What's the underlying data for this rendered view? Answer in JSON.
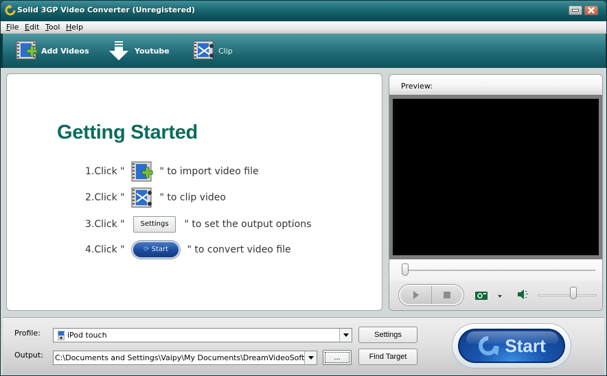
{
  "window": {
    "title": "Solid 3GP Video Converter (Unregistered)",
    "minimize_icon": "minimize-icon",
    "close_icon": "close-icon"
  },
  "menu": [
    {
      "label_u": "F",
      "label_rest": "ile"
    },
    {
      "label_u": "E",
      "label_rest": "dit"
    },
    {
      "label_u": "T",
      "label_rest": "ool"
    },
    {
      "label_u": "H",
      "label_rest": "elp"
    }
  ],
  "toolbar": {
    "add_videos": {
      "label": "Add Videos",
      "icon": "film-add-icon"
    },
    "youtube": {
      "label": "Youtube",
      "icon": "download-arrow-icon"
    },
    "clip": {
      "label": "Clip",
      "icon": "film-scissors-icon"
    }
  },
  "getting_started": {
    "title": "Getting Started",
    "steps": [
      {
        "prefix": "1.Click \" ",
        "suffix": " \" to import video file",
        "icon": "film-add-icon"
      },
      {
        "prefix": "2.Click \" ",
        "suffix": " \" to clip video",
        "icon": "film-scissors-icon"
      },
      {
        "prefix": "3.Click \" ",
        "suffix": " \" to set the output options",
        "button": "Settings"
      },
      {
        "prefix": "4.Click \" ",
        "suffix": " \" to convert video file",
        "button": "Start"
      }
    ]
  },
  "preview": {
    "label": "Preview:",
    "seek_position": 0,
    "volume_level": 0.6
  },
  "bottom": {
    "profile_label": "Profile:",
    "profile_value": "iPod touch",
    "output_label": "Output:",
    "output_value": "C:\\Documents and Settings\\Vaipy\\My Documents\\DreamVideoSoft\\OutPut",
    "browse_label": "...",
    "settings_label": "Settings",
    "find_target_label": "Find Target",
    "start_label": "Start"
  },
  "colors": {
    "title_teal": "#1e6c76",
    "heading_green": "#0b6b5c",
    "start_blue": "#1a56b0",
    "close_red": "#c95d3c"
  }
}
